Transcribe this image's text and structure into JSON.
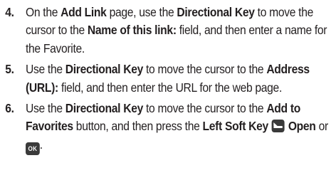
{
  "steps": [
    {
      "number": "4.",
      "parts": {
        "t1": "On the ",
        "b1": "Add Link",
        "t2": " page, use the ",
        "b2": "Directional Key",
        "t3": " to move the cursor to the ",
        "b3": "Name of this link:",
        "t4": " field, and then enter a name for the Favorite."
      }
    },
    {
      "number": "5.",
      "parts": {
        "t1": "Use the ",
        "b1": "Directional Key",
        "t2": " to move the cursor to the ",
        "b2": "Address (URL):",
        "t3": " field, and then enter the URL for the web page."
      }
    },
    {
      "number": "6.",
      "parts": {
        "t1": "Use the ",
        "b1": "Directional Key",
        "t2": " to move the cursor to the ",
        "b2": "Add to Favorites",
        "t3": " button, and then press the ",
        "b3": "Left Soft Key",
        "t4": " ",
        "b4": "Open",
        "t5": " or ",
        "ok_label": "OK",
        "t6": "."
      }
    }
  ],
  "icons": {
    "left_soft_key": "left-soft-key-icon",
    "ok_key": "ok-key-icon"
  }
}
